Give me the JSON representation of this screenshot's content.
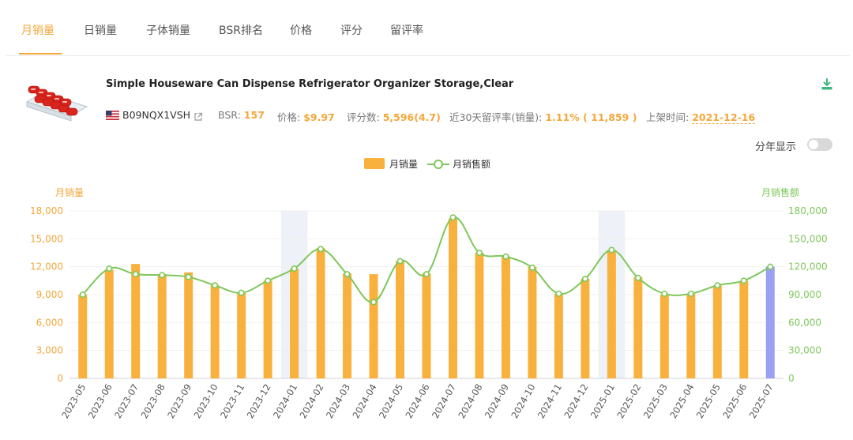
{
  "tabs": [
    "月销量",
    "日销量",
    "子体销量",
    "BSR排名",
    "价格",
    "评分",
    "留评率"
  ],
  "active_tab": 0,
  "product": {
    "title": "Simple Houseware Can Dispense Refrigerator Organizer Storage,Clear",
    "asin": "B09NQX1VSH",
    "bsr_label": "BSR:",
    "bsr_value": "157",
    "price_label": "价格:",
    "price_value": "$9.97",
    "rating_label": "评分数:",
    "rating_value": "5,596(4.7)",
    "review_rate_label": "近30天留评率(销量):",
    "review_rate_value": "1.11% ( 11,859 )",
    "launch_label": "上架时间:",
    "launch_value": "2021-12-16"
  },
  "controls": {
    "year_toggle_label": "分年显示",
    "year_toggle_on": false
  },
  "legend": {
    "bar": "月销量",
    "line": "月销售额"
  },
  "colors": {
    "accent": "#f4a73a",
    "bar": "#f8b13d",
    "bar_current": "#9aa0f2",
    "line": "#7ec75a",
    "highlight_band": "#eef1f7"
  },
  "icons": {
    "download": "download-icon",
    "share": "share-icon",
    "flag": "us-flag-icon"
  },
  "chart_data": {
    "type": "bar",
    "categories": [
      "2023-05",
      "2023-06",
      "2023-07",
      "2023-08",
      "2023-09",
      "2023-10",
      "2023-11",
      "2023-12",
      "2024-01",
      "2024-02",
      "2024-03",
      "2024-04",
      "2024-05",
      "2024-06",
      "2024-07",
      "2024-08",
      "2024-09",
      "2024-10",
      "2024-11",
      "2024-12",
      "2025-01",
      "2025-02",
      "2025-03",
      "2025-04",
      "2025-05",
      "2025-06",
      "2025-07"
    ],
    "highlight_categories": [
      "2024-01",
      "2025-01"
    ],
    "series": [
      {
        "name": "月销量",
        "type": "bar",
        "axis": "left",
        "values": [
          9000,
          11700,
          12300,
          11200,
          11400,
          10000,
          9200,
          10500,
          11800,
          14000,
          11300,
          11200,
          12600,
          11300,
          17200,
          13500,
          13100,
          12000,
          9100,
          10700,
          13800,
          10900,
          9000,
          9100,
          10000,
          10500,
          12000
        ]
      },
      {
        "name": "月销售额",
        "type": "line",
        "axis": "right",
        "values": [
          90000,
          118000,
          112000,
          111000,
          109000,
          100000,
          92000,
          105000,
          118000,
          139000,
          112000,
          82000,
          126000,
          112000,
          173000,
          135000,
          131000,
          119000,
          91000,
          107000,
          138000,
          108000,
          91000,
          91000,
          100000,
          105000,
          120000
        ]
      }
    ],
    "ylabel_left": "月销量",
    "ylabel_right": "月销售额",
    "ylim_left": [
      0,
      18000
    ],
    "ylim_right": [
      0,
      180000
    ],
    "yticks_left": [
      "0",
      "3,000",
      "6,000",
      "9,000",
      "12,000",
      "15,000",
      "18,000"
    ],
    "yticks_right": [
      "0",
      "30,000",
      "60,000",
      "90,000",
      "120,000",
      "150,000",
      "180,000"
    ],
    "grid": true,
    "legend_position": "top-center"
  }
}
